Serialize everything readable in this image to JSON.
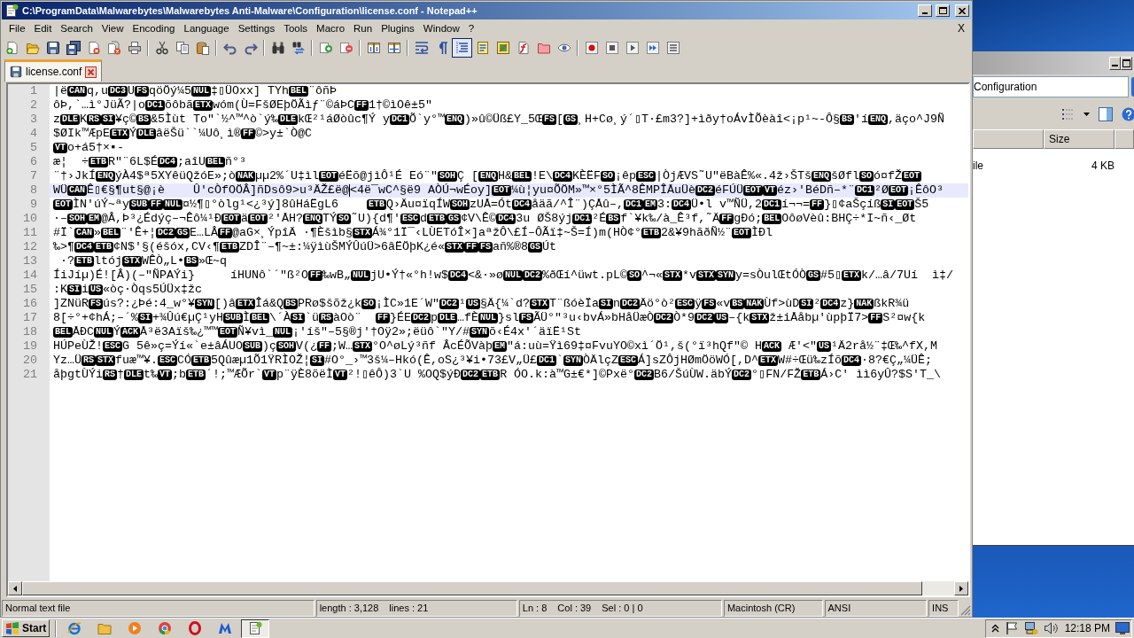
{
  "window": {
    "title": "C:\\ProgramData\\Malwarebytes\\Malwarebytes Anti-Malware\\Configuration\\license.conf - Notepad++"
  },
  "menu_bar": {
    "items": [
      "File",
      "Edit",
      "Search",
      "View",
      "Encoding",
      "Language",
      "Settings",
      "Tools",
      "Macro",
      "Run",
      "Plugins",
      "Window",
      "?"
    ],
    "close_label": "X"
  },
  "toolbar": {
    "groups": [
      {
        "buttons": [
          {
            "kind": "new",
            "pressed": false
          },
          {
            "kind": "open",
            "pressed": false
          },
          {
            "kind": "save",
            "pressed": false
          },
          {
            "kind": "saveall",
            "pressed": false
          },
          {
            "kind": "close",
            "pressed": false
          },
          {
            "kind": "closeall",
            "pressed": false
          },
          {
            "kind": "print",
            "pressed": false
          }
        ]
      },
      {
        "buttons": [
          {
            "kind": "cut",
            "pressed": false
          },
          {
            "kind": "copy",
            "pressed": false
          },
          {
            "kind": "paste",
            "pressed": false
          }
        ]
      },
      {
        "buttons": [
          {
            "kind": "undo",
            "pressed": false
          },
          {
            "kind": "redo",
            "pressed": false
          }
        ]
      },
      {
        "buttons": [
          {
            "kind": "find",
            "pressed": false
          },
          {
            "kind": "replace",
            "pressed": false
          }
        ]
      },
      {
        "buttons": [
          {
            "kind": "zoomin",
            "pressed": false
          },
          {
            "kind": "zoomout",
            "pressed": false
          }
        ]
      },
      {
        "buttons": [
          {
            "kind": "syncv",
            "pressed": false
          },
          {
            "kind": "synch",
            "pressed": false
          }
        ]
      },
      {
        "buttons": [
          {
            "kind": "wrap",
            "pressed": false
          },
          {
            "kind": "allchars",
            "pressed": false
          },
          {
            "kind": "indent",
            "pressed": true
          },
          {
            "kind": "udl",
            "pressed": false
          },
          {
            "kind": "docmap",
            "pressed": false
          },
          {
            "kind": "funclist",
            "pressed": false
          },
          {
            "kind": "workspace",
            "pressed": false
          },
          {
            "kind": "monitor",
            "pressed": false
          }
        ]
      },
      {
        "buttons": [
          {
            "kind": "record",
            "pressed": false
          },
          {
            "kind": "stop",
            "pressed": false
          },
          {
            "kind": "play",
            "pressed": false
          },
          {
            "kind": "playmulti",
            "pressed": false
          },
          {
            "kind": "savemacro",
            "pressed": false
          }
        ]
      }
    ]
  },
  "tabs": [
    {
      "label": "license.conf",
      "selected": true
    }
  ],
  "editor": {
    "lines": [
      {
        "number": "1",
        "current": false,
        "segments": [
          {
            "kind": "text",
            "text": "|ë"
          },
          {
            "kind": "control",
            "text": "CAN"
          },
          {
            "kind": "text",
            "text": "q,u"
          },
          {
            "kind": "control",
            "text": "DC3"
          },
          {
            "kind": "text",
            "text": "U"
          },
          {
            "kind": "control",
            "text": "FS"
          },
          {
            "kind": "text",
            "text": "qöÖý¼5"
          },
          {
            "kind": "control",
            "text": "NUL"
          },
          {
            "kind": "text",
            "text": "‡▯ÜOxx] TYh"
          },
          {
            "kind": "control",
            "text": "BEL"
          },
          {
            "kind": "text",
            "text": "¨ôñÞ"
          }
        ]
      },
      {
        "number": "2",
        "current": false,
        "segments": [
          {
            "kind": "text",
            "text": "ôÞ,`…ì°JüÃ?|o"
          },
          {
            "kind": "control",
            "text": "DC1"
          },
          {
            "kind": "text",
            "text": "õôbã"
          },
          {
            "kind": "control",
            "text": "ETX"
          },
          {
            "kind": "text",
            "text": "wóm(Ù=FšØEþÖÃìƒ¨©áÞC"
          },
          {
            "kind": "control",
            "text": "FF"
          },
          {
            "kind": "text",
            "text": "1†©ìOê±5″"
          }
        ]
      },
      {
        "number": "3",
        "current": false,
        "segments": [
          {
            "kind": "text",
            "text": "z"
          },
          {
            "kind": "control",
            "text": "DLE"
          },
          {
            "kind": "text",
            "text": "K"
          },
          {
            "kind": "control",
            "text": "RS"
          },
          {
            "kind": "control",
            "text": "SI"
          },
          {
            "kind": "text",
            "text": "¥ç©"
          },
          {
            "kind": "control",
            "text": "BS"
          },
          {
            "kind": "text",
            "text": "&5Ìùt To″`½^™^ò`ý‰"
          },
          {
            "kind": "control",
            "text": "DLE"
          },
          {
            "kind": "text",
            "text": "kŒ²¹áØòûc¶Ý y"
          },
          {
            "kind": "control",
            "text": "DC1"
          },
          {
            "kind": "text",
            "text": "Õ`y°™"
          },
          {
            "kind": "control",
            "text": "ENQ"
          },
          {
            "kind": "text",
            "text": ")»û©Üß£Y_5Œ"
          },
          {
            "kind": "control",
            "text": "FS"
          },
          {
            "kind": "text",
            "text": "["
          },
          {
            "kind": "control",
            "text": "GS"
          },
          {
            "kind": "text",
            "text": "¸H+Cø¸ý´▯T·£m3?]+ìðy†oÁvÌÕèàî<¡p¹~-Ô§"
          },
          {
            "kind": "control",
            "text": "BS"
          },
          {
            "kind": "text",
            "text": "′í"
          },
          {
            "kind": "control",
            "text": "ENQ"
          },
          {
            "kind": "text",
            "text": ",äço^J9Ñ"
          }
        ]
      },
      {
        "number": "4",
        "current": false,
        "segments": [
          {
            "kind": "text",
            "text": "$ØIk™ÆpE"
          },
          {
            "kind": "control",
            "text": "ETX"
          },
          {
            "kind": "text",
            "text": "Ý"
          },
          {
            "kind": "control",
            "text": "DLE"
          },
          {
            "kind": "text",
            "text": "âëŠü``¼Uô¸ì®"
          },
          {
            "kind": "control",
            "text": "FF"
          },
          {
            "kind": "text",
            "text": "©>y±`Ò@C"
          }
        ]
      },
      {
        "number": "5",
        "current": false,
        "segments": [
          {
            "kind": "control",
            "text": "VT"
          },
          {
            "kind": "text",
            "text": "o+á5†×▪-"
          }
        ]
      },
      {
        "number": "6",
        "current": false,
        "segments": [
          {
            "kind": "text",
            "text": "æ¦  ÷"
          },
          {
            "kind": "control",
            "text": "ETB"
          },
          {
            "kind": "text",
            "text": "R″¨6L$É"
          },
          {
            "kind": "control",
            "text": "DC4"
          },
          {
            "kind": "text",
            "text": ";aîU"
          },
          {
            "kind": "control",
            "text": "BEL"
          },
          {
            "kind": "text",
            "text": "ñ°³"
          }
        ]
      },
      {
        "number": "7",
        "current": false,
        "segments": [
          {
            "kind": "text",
            "text": "¨†›JkÍ"
          },
          {
            "kind": "control",
            "text": "ENQ"
          },
          {
            "kind": "text",
            "text": "ýÀ4$ª5XYêüQžóE»;ò"
          },
          {
            "kind": "control",
            "text": "NAK"
          },
          {
            "kind": "text",
            "text": "µµ2%´U‡ìl"
          },
          {
            "kind": "control",
            "text": "EOT"
          },
          {
            "kind": "text",
            "text": "éËõ@jìÔ¹É Eó¨\""
          },
          {
            "kind": "control",
            "text": "SOH"
          },
          {
            "kind": "text",
            "text": "Ç ["
          },
          {
            "kind": "control",
            "text": "ENQ"
          },
          {
            "kind": "text",
            "text": "H&"
          },
          {
            "kind": "control",
            "text": "BEL"
          },
          {
            "kind": "text",
            "text": "!E\\"
          },
          {
            "kind": "control",
            "text": "DC4"
          },
          {
            "kind": "text",
            "text": "KÈËF"
          },
          {
            "kind": "control",
            "text": "SO"
          },
          {
            "kind": "text",
            "text": "¡êp"
          },
          {
            "kind": "control",
            "text": "ESC"
          },
          {
            "kind": "text",
            "text": "|ÒjÆVS˜U″ëBàÊ%«.4ž›ŠTš"
          },
          {
            "kind": "control",
            "text": "ENQ"
          },
          {
            "kind": "text",
            "text": "šØfl"
          },
          {
            "kind": "control",
            "text": "SO"
          },
          {
            "kind": "text",
            "text": "ó¤fŽ"
          },
          {
            "kind": "control",
            "text": "EOT"
          }
        ]
      },
      {
        "number": "8",
        "current": true,
        "segments": [
          {
            "kind": "text",
            "text": "WÜ"
          },
          {
            "kind": "control",
            "text": "CAN"
          },
          {
            "kind": "text",
            "text": "Ê▯€§¶ut§@¡è    Û'cÒfOÖÂ]ñDsô9>u³ÄŽ£ë@"
          },
          {
            "kind": "caret"
          },
          {
            "kind": "text",
            "text": "<4ë¯wC^§ë9 AÒÚ¬wÉoy]"
          },
          {
            "kind": "control",
            "text": "EOT"
          },
          {
            "kind": "text",
            "text": "¼ù¦yu¤ÕÖM»™×°5ÌÃ^8ÊMPÎÅuÜè"
          },
          {
            "kind": "control",
            "text": "DC2"
          },
          {
            "kind": "text",
            "text": "éFÚÜ"
          },
          {
            "kind": "control",
            "text": "EOT"
          },
          {
            "kind": "control",
            "text": "VT"
          },
          {
            "kind": "text",
            "text": "éz›′BéDñ–*¨"
          },
          {
            "kind": "control",
            "text": "DC1"
          },
          {
            "kind": "text",
            "text": "²Ø"
          },
          {
            "kind": "control",
            "text": "EOT"
          },
          {
            "kind": "text",
            "text": "¡ÊôO³"
          }
        ]
      },
      {
        "number": "9",
        "current": false,
        "segments": [
          {
            "kind": "control",
            "text": "EOT"
          },
          {
            "kind": "text",
            "text": "ÌN′úÝ~ªy"
          },
          {
            "kind": "control",
            "text": "SUB"
          },
          {
            "kind": "control",
            "text": "FF"
          },
          {
            "kind": "control",
            "text": "NUL"
          },
          {
            "kind": "text",
            "text": "¤½¶▯°òlg¹<¿³ý]8ûHáËgL6    "
          },
          {
            "kind": "control",
            "text": "ETB"
          },
          {
            "kind": "text",
            "text": "Q›Äu¤ïqÍW"
          },
          {
            "kind": "control",
            "text": "SOH"
          },
          {
            "kind": "text",
            "text": "zUÅ=Ót"
          },
          {
            "kind": "control",
            "text": "DC4"
          },
          {
            "kind": "text",
            "text": "åäã/^Î¨)ÇÅû–,"
          },
          {
            "kind": "control",
            "text": "DC1"
          },
          {
            "kind": "control",
            "text": "EM"
          },
          {
            "kind": "text",
            "text": "3:"
          },
          {
            "kind": "control",
            "text": "DC4"
          },
          {
            "kind": "text",
            "text": "Ü•l v™ÑÜ,2"
          },
          {
            "kind": "control",
            "text": "DC1"
          },
          {
            "kind": "text",
            "text": "í¬¬="
          },
          {
            "kind": "control",
            "text": "FF"
          },
          {
            "kind": "text",
            "text": "}▯¢aŠçíß"
          },
          {
            "kind": "control",
            "text": "SI"
          },
          {
            "kind": "control",
            "text": "EOT"
          },
          {
            "kind": "text",
            "text": "Š5"
          }
        ]
      },
      {
        "number": "10",
        "current": false,
        "segments": [
          {
            "kind": "text",
            "text": "·–"
          },
          {
            "kind": "control",
            "text": "SOH"
          },
          {
            "kind": "control",
            "text": "EM"
          },
          {
            "kind": "text",
            "text": "@Â,Þ³¿Édýç–¬Êô¼¹Ð"
          },
          {
            "kind": "control",
            "text": "EOT"
          },
          {
            "kind": "text",
            "text": "ä"
          },
          {
            "kind": "control",
            "text": "EOT"
          },
          {
            "kind": "text",
            "text": "²'ÅH?"
          },
          {
            "kind": "control",
            "text": "ENQ"
          },
          {
            "kind": "text",
            "text": "TÝ"
          },
          {
            "kind": "control",
            "text": "SO"
          },
          {
            "kind": "text",
            "text": "˜U){d¶'"
          },
          {
            "kind": "control",
            "text": "ESC"
          },
          {
            "kind": "text",
            "text": "d"
          },
          {
            "kind": "control",
            "text": "ETB"
          },
          {
            "kind": "control",
            "text": "GS"
          },
          {
            "kind": "text",
            "text": "¢V\\Ê©"
          },
          {
            "kind": "control",
            "text": "DC4"
          },
          {
            "kind": "text",
            "text": "3u ØŠ8ýj"
          },
          {
            "kind": "control",
            "text": "DC1"
          },
          {
            "kind": "text",
            "text": "²É"
          },
          {
            "kind": "control",
            "text": "BS"
          },
          {
            "kind": "text",
            "text": "f`¥k‰/à_Ê³f,˜Ä"
          },
          {
            "kind": "control",
            "text": "FF"
          },
          {
            "kind": "text",
            "text": "gÐó;"
          },
          {
            "kind": "control",
            "text": "BEL"
          },
          {
            "kind": "text",
            "text": "OôøVèû:BHÇ÷*I~ñ‹_Øt"
          }
        ]
      },
      {
        "number": "11",
        "current": false,
        "segments": [
          {
            "kind": "text",
            "text": "#Ï`"
          },
          {
            "kind": "control",
            "text": "CAN"
          },
          {
            "kind": "text",
            "text": "»"
          },
          {
            "kind": "control",
            "text": "BEL"
          },
          {
            "kind": "text",
            "text": "¨′Ê+¦"
          },
          {
            "kind": "control",
            "text": "DC2"
          },
          {
            "kind": "control",
            "text": "GS"
          },
          {
            "kind": "text",
            "text": "E…LÂ"
          },
          {
            "kind": "control",
            "text": "FF"
          },
          {
            "kind": "text",
            "text": "@aG×¸ÝpîÄ ·¶Èšìb§"
          },
          {
            "kind": "control",
            "text": "STX"
          },
          {
            "kind": "text",
            "text": "Á¾°1Ï¯‹LÙETóÎ×]aªžÔ\\£Í–ÔÃï‡~Š=Í)m(HÒ¢°"
          },
          {
            "kind": "control",
            "text": "ETB"
          },
          {
            "kind": "text",
            "text": "2&¥9hãðÑ½¨"
          },
          {
            "kind": "control",
            "text": "EOT"
          },
          {
            "kind": "text",
            "text": "ÌÐl"
          }
        ]
      },
      {
        "number": "12",
        "current": false,
        "segments": [
          {
            "kind": "text",
            "text": "‰>¶"
          },
          {
            "kind": "control",
            "text": "DC4"
          },
          {
            "kind": "control",
            "text": "ETB"
          },
          {
            "kind": "text",
            "text": "¢N$'§(éšóx,CV‹¶"
          },
          {
            "kind": "control",
            "text": "ETB"
          },
          {
            "kind": "text",
            "text": "ZDÎ¨–¶~±:¼ÿìùŠMÝÛúÜ>6âËÖþK¿é«"
          },
          {
            "kind": "control",
            "text": "STX"
          },
          {
            "kind": "control",
            "text": "FF"
          },
          {
            "kind": "control",
            "text": "FS"
          },
          {
            "kind": "text",
            "text": "añ%®8"
          },
          {
            "kind": "control",
            "text": "GS"
          },
          {
            "kind": "text",
            "text": "Út"
          }
        ]
      },
      {
        "number": "13",
        "current": false,
        "segments": [
          {
            "kind": "text",
            "text": " ·?"
          },
          {
            "kind": "control",
            "text": "ETB"
          },
          {
            "kind": "text",
            "text": "ltój"
          },
          {
            "kind": "control",
            "text": "STX"
          },
          {
            "kind": "text",
            "text": "WÊÒ„L•"
          },
          {
            "kind": "control",
            "text": "BS"
          },
          {
            "kind": "text",
            "text": "»Œ~q"
          }
        ]
      },
      {
        "number": "14",
        "current": false,
        "segments": [
          {
            "kind": "text",
            "text": "ÍiJíµ)É![Â)(–″ÑPAÝi}     íHUNô`´″ß²O"
          },
          {
            "kind": "control",
            "text": "FF"
          },
          {
            "kind": "text",
            "text": "‰wB„"
          },
          {
            "kind": "control",
            "text": "NUL"
          },
          {
            "kind": "text",
            "text": "jU•Ý†«°h!w$"
          },
          {
            "kind": "control",
            "text": "DC4"
          },
          {
            "kind": "text",
            "text": "<&·»ø"
          },
          {
            "kind": "control",
            "text": "NUL"
          },
          {
            "kind": "control",
            "text": "DC2"
          },
          {
            "kind": "text",
            "text": "%ðŒí^üwt.pL©"
          },
          {
            "kind": "control",
            "text": "SO"
          },
          {
            "kind": "text",
            "text": "^¬«"
          },
          {
            "kind": "control",
            "text": "STX"
          },
          {
            "kind": "text",
            "text": "*v"
          },
          {
            "kind": "control",
            "text": "STX"
          },
          {
            "kind": "control",
            "text": "SYN"
          },
          {
            "kind": "text",
            "text": "y=sÒulŒtÓÒ"
          },
          {
            "kind": "control",
            "text": "GS"
          },
          {
            "kind": "text",
            "text": "#5▯"
          },
          {
            "kind": "control",
            "text": "ETX"
          },
          {
            "kind": "text",
            "text": "k/…â/7Uí  ì‡/"
          }
        ]
      },
      {
        "number": "15",
        "current": false,
        "segments": [
          {
            "kind": "text",
            "text": ":K"
          },
          {
            "kind": "control",
            "text": "SI"
          },
          {
            "kind": "text",
            "text": "i"
          },
          {
            "kind": "control",
            "text": "US"
          },
          {
            "kind": "text",
            "text": "«òç·Òqs5ÚÜx‡žc"
          }
        ]
      },
      {
        "number": "16",
        "current": false,
        "segments": [
          {
            "kind": "text",
            "text": "]ZNüR"
          },
          {
            "kind": "control",
            "text": "FS"
          },
          {
            "kind": "text",
            "text": "ús?:¿Þé:4_w°¥"
          },
          {
            "kind": "control",
            "text": "SYN"
          },
          {
            "kind": "text",
            "text": "[)â"
          },
          {
            "kind": "control",
            "text": "ETX"
          },
          {
            "kind": "text",
            "text": "Îá&Q"
          },
          {
            "kind": "control",
            "text": "BS"
          },
          {
            "kind": "text",
            "text": "PRø$šõž¿k"
          },
          {
            "kind": "control",
            "text": "SO"
          },
          {
            "kind": "text",
            "text": "¡ÌC»1E´W″"
          },
          {
            "kind": "control",
            "text": "DC2"
          },
          {
            "kind": "text",
            "text": "¹"
          },
          {
            "kind": "control",
            "text": "US"
          },
          {
            "kind": "text",
            "text": "§Ä{¼`d?"
          },
          {
            "kind": "control",
            "text": "STX"
          },
          {
            "kind": "text",
            "text": "T¨ßóèÏa"
          },
          {
            "kind": "control",
            "text": "SI"
          },
          {
            "kind": "text",
            "text": "n"
          },
          {
            "kind": "control",
            "text": "DC2"
          },
          {
            "kind": "text",
            "text": "Äö°ò²"
          },
          {
            "kind": "control",
            "text": "ESC"
          },
          {
            "kind": "text",
            "text": "ÿ"
          },
          {
            "kind": "control",
            "text": "FS"
          },
          {
            "kind": "text",
            "text": "«v"
          },
          {
            "kind": "control",
            "text": "BS"
          },
          {
            "kind": "control",
            "text": "NAK"
          },
          {
            "kind": "text",
            "text": "Ùf>ùD"
          },
          {
            "kind": "control",
            "text": "SI"
          },
          {
            "kind": "text",
            "text": "²"
          },
          {
            "kind": "control",
            "text": "DC4"
          },
          {
            "kind": "text",
            "text": "z}"
          },
          {
            "kind": "control",
            "text": "NAK"
          },
          {
            "kind": "text",
            "text": "ßkR¾ü"
          }
        ]
      },
      {
        "number": "17",
        "current": false,
        "segments": [
          {
            "kind": "text",
            "text": "8[÷°+¢hÁ;–´%"
          },
          {
            "kind": "control",
            "text": "SI"
          },
          {
            "kind": "text",
            "text": "+¾Ûú€µÇ¹yH"
          },
          {
            "kind": "control",
            "text": "SUB"
          },
          {
            "kind": "text",
            "text": "Ì"
          },
          {
            "kind": "control",
            "text": "BEL"
          },
          {
            "kind": "text",
            "text": "\\´À"
          },
          {
            "kind": "control",
            "text": "SI"
          },
          {
            "kind": "text",
            "text": "`ü"
          },
          {
            "kind": "control",
            "text": "RS"
          },
          {
            "kind": "text",
            "text": "àOò¨  "
          },
          {
            "kind": "control",
            "text": "FF"
          },
          {
            "kind": "text",
            "text": "}ÉE"
          },
          {
            "kind": "control",
            "text": "DC2"
          },
          {
            "kind": "text",
            "text": "p"
          },
          {
            "kind": "control",
            "text": "DLE"
          },
          {
            "kind": "text",
            "text": "…fÈ"
          },
          {
            "kind": "control",
            "text": "NUL"
          },
          {
            "kind": "text",
            "text": "}sl"
          },
          {
            "kind": "control",
            "text": "FS"
          },
          {
            "kind": "text",
            "text": "ÃÜ°″³u‹bvÁ»bHåÜæÒ"
          },
          {
            "kind": "control",
            "text": "DC2"
          },
          {
            "kind": "text",
            "text": "Ò*9"
          },
          {
            "kind": "control",
            "text": "DC2"
          },
          {
            "kind": "control",
            "text": "US"
          },
          {
            "kind": "text",
            "text": "–{k"
          },
          {
            "kind": "control",
            "text": "STX"
          },
          {
            "kind": "text",
            "text": "ž±iÅåbµ′ùpþÏ7>"
          },
          {
            "kind": "control",
            "text": "FF"
          },
          {
            "kind": "text",
            "text": "S²¤w{k"
          }
        ]
      },
      {
        "number": "18",
        "current": false,
        "segments": [
          {
            "kind": "control",
            "text": "BEL"
          },
          {
            "kind": "text",
            "text": "ÅÐC"
          },
          {
            "kind": "control",
            "text": "NUL"
          },
          {
            "kind": "text",
            "text": "Ý"
          },
          {
            "kind": "control",
            "text": "ACK"
          },
          {
            "kind": "text",
            "text": "Å³ë3Aïš‰¿™™"
          },
          {
            "kind": "control",
            "text": "EOT"
          },
          {
            "kind": "text",
            "text": "Ñ¥vì_"
          },
          {
            "kind": "control",
            "text": "NUL"
          },
          {
            "kind": "text",
            "text": "¡'íš″–5§®j′†Oÿ2»;ëüô`″Y/#"
          },
          {
            "kind": "control",
            "text": "SYN"
          },
          {
            "kind": "text",
            "text": "õ‹É4x′´äïË¹St"
          }
        ]
      },
      {
        "number": "19",
        "current": false,
        "segments": [
          {
            "kind": "text",
            "text": "HÚPeÙŽ!"
          },
          {
            "kind": "control",
            "text": "ESC"
          },
          {
            "kind": "text",
            "text": "G 5ê»ç=Ýí«`e±âÁUO"
          },
          {
            "kind": "control",
            "text": "SUB"
          },
          {
            "kind": "text",
            "text": ")ç"
          },
          {
            "kind": "control",
            "text": "SOH"
          },
          {
            "kind": "text",
            "text": "V(¿"
          },
          {
            "kind": "control",
            "text": "FF"
          },
          {
            "kind": "text",
            "text": ";W…"
          },
          {
            "kind": "control",
            "text": "STX"
          },
          {
            "kind": "text",
            "text": "°O^øLý³ñf ÂcÉÕVàþ"
          },
          {
            "kind": "control",
            "text": "EM"
          },
          {
            "kind": "text",
            "text": "″á:uù=Ÿì69‡¤FvuYO©xì´Ö¹,š(°ï³hQf″© H"
          },
          {
            "kind": "control",
            "text": "ACK"
          },
          {
            "kind": "text",
            "text": " Æ′<″"
          },
          {
            "kind": "control",
            "text": "US"
          },
          {
            "kind": "text",
            "text": "¹Ä2rå½¨‡Œ‰^fX,M"
          }
        ]
      },
      {
        "number": "20",
        "current": false,
        "segments": [
          {
            "kind": "text",
            "text": "Yz…Ü"
          },
          {
            "kind": "control",
            "text": "RS"
          },
          {
            "kind": "control",
            "text": "STX"
          },
          {
            "kind": "text",
            "text": "fuæ™¥."
          },
          {
            "kind": "control",
            "text": "ESC"
          },
          {
            "kind": "text",
            "text": "CÓ"
          },
          {
            "kind": "control",
            "text": "ETB"
          },
          {
            "kind": "text",
            "text": "5Qûæµ1Õ1ŸRÌOŽ¦"
          },
          {
            "kind": "control",
            "text": "SI"
          },
          {
            "kind": "text",
            "text": "#O°_›™3š¼–Hkó(Ê,oS¿³¥i•73£V„Ü£"
          },
          {
            "kind": "control",
            "text": "DC1"
          },
          {
            "kind": "text",
            "text": "`"
          },
          {
            "kind": "control",
            "text": "SYN"
          },
          {
            "kind": "text",
            "text": "ÒÄlçZ"
          },
          {
            "kind": "control",
            "text": "ESC"
          },
          {
            "kind": "text",
            "text": "Á]sZÔjHØmÖöWÓ[,D^"
          },
          {
            "kind": "control",
            "text": "ETX"
          },
          {
            "kind": "text",
            "text": "W#÷Œü‰zÍõ"
          },
          {
            "kind": "control",
            "text": "DC4"
          },
          {
            "kind": "text",
            "text": "·8?€Ç„¼ÜÊ;"
          }
        ]
      },
      {
        "number": "21",
        "current": false,
        "segments": [
          {
            "kind": "text",
            "text": "åþgtÙÝi"
          },
          {
            "kind": "control",
            "text": "RS"
          },
          {
            "kind": "text",
            "text": "†"
          },
          {
            "kind": "control",
            "text": "DLE"
          },
          {
            "kind": "text",
            "text": "t‰"
          },
          {
            "kind": "control",
            "text": "VT"
          },
          {
            "kind": "text",
            "text": ";b"
          },
          {
            "kind": "control",
            "text": "ETB"
          },
          {
            "kind": "text",
            "text": "´!;™ÆÕr`"
          },
          {
            "kind": "control",
            "text": "VT"
          },
          {
            "kind": "text",
            "text": "p¨ÿÈ8õëÌ"
          },
          {
            "kind": "control",
            "text": "VT"
          },
          {
            "kind": "text",
            "text": "²!▯êÔ)3`U %OQ$ýÐ"
          },
          {
            "kind": "control",
            "text": "DC2"
          },
          {
            "kind": "control",
            "text": "ETB"
          },
          {
            "kind": "text",
            "text": "R ÓO.k:à™G±€*]©Pxë°"
          },
          {
            "kind": "control",
            "text": "DC2"
          },
          {
            "kind": "text",
            "text": "B6/ŠúÙW.äbÝ"
          },
          {
            "kind": "control",
            "text": "DC2"
          },
          {
            "kind": "text",
            "text": "°▯FN/FŽ"
          },
          {
            "kind": "control",
            "text": "ETB"
          },
          {
            "kind": "text",
            "text": "Á›C′ ìì6yÛ?$S'T_\\"
          }
        ]
      }
    ]
  },
  "status_bar": {
    "sections": [
      {
        "texts": [
          "Normal text file"
        ]
      },
      {
        "texts": [
          "length : 3,128",
          "lines : 21"
        ]
      },
      {
        "texts": [
          "Ln : 8",
          "Col : 39",
          "Sel : 0 | 0"
        ]
      },
      {
        "texts": [
          "Macintosh (CR)"
        ]
      },
      {
        "texts": [
          "ANSI"
        ]
      },
      {
        "texts": [
          "INS"
        ]
      }
    ]
  },
  "background_window": {
    "address": "Configuration",
    "column_header": "Size",
    "rows": [
      {
        "cells": [
          "ile",
          "4 KB"
        ]
      }
    ]
  },
  "taskbar": {
    "start_label": "Start",
    "buttons": [
      {
        "kind": "globe",
        "selected": false
      },
      {
        "kind": "folder",
        "selected": false
      },
      {
        "kind": "player",
        "selected": false
      },
      {
        "kind": "wheel",
        "selected": false
      },
      {
        "kind": "ring",
        "selected": false
      },
      {
        "kind": "mlogo",
        "selected": false
      },
      {
        "kind": "notepad",
        "selected": true
      }
    ],
    "clock": "12:18 PM"
  }
}
